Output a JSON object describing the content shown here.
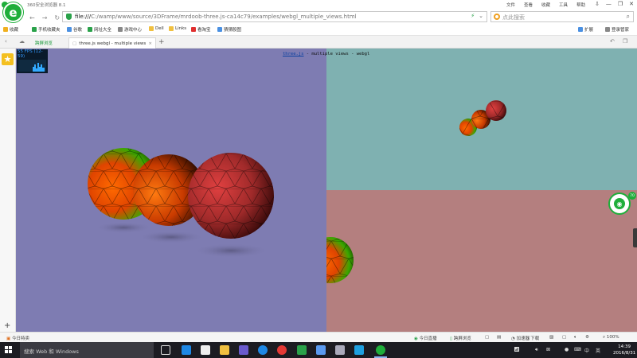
{
  "window": {
    "app_title": "360安全浏览器 8.1",
    "menu": [
      "文件",
      "查看",
      "收藏",
      "工具",
      "帮助"
    ],
    "controls": {
      "pin": "⇩",
      "minimize": "—",
      "restore": "❐",
      "close": "✕"
    }
  },
  "address": {
    "url_prefix": "file:///",
    "url_rest": "C:/wamp/www/source/3DFrame/mrdoob-three.js-ca14c79/examples/webgl_multiple_views.html",
    "search_placeholder": "点此搜索"
  },
  "bookmarks": {
    "items": [
      {
        "label": "收藏",
        "color": "#f0b020"
      },
      {
        "label": "手机收藏夹",
        "color": "#2aa24a"
      },
      {
        "label": "谷歌",
        "color": "#4a90e2"
      },
      {
        "label": "网址大全",
        "color": "#2aa24a"
      },
      {
        "label": "游戏中心",
        "color": "#888888"
      },
      {
        "label": "Dell",
        "color": "#f0c040"
      },
      {
        "label": "Links",
        "color": "#f0c040"
      },
      {
        "label": "看淘宝",
        "color": "#e03030"
      },
      {
        "label": "猜猜股图",
        "color": "#4a90e2"
      }
    ],
    "extensions": "扩展",
    "login": "登录管家"
  },
  "tabs": {
    "items": [
      {
        "label": "跨屏浏览"
      },
      {
        "label": "three.js webgl - multiple views"
      }
    ],
    "close": "×",
    "add": "+"
  },
  "sidebar": {
    "star": "★",
    "add": "+"
  },
  "page": {
    "stats_text": "55 FPS (12-59)",
    "info_link": "three.js",
    "info_rest": " - multiple views - webgl"
  },
  "widget": {
    "badge": "70"
  },
  "status": {
    "left": "今日特卖",
    "items": [
      "今日直播",
      "跨屏浏览",
      "加速器",
      "下载"
    ],
    "zoom": "100%"
  },
  "taskbar": {
    "search": "搜索 Web 和 Windows",
    "tray_lang": "中",
    "tray_ime": "英",
    "time": "14:39",
    "date": "2016/8/31"
  }
}
